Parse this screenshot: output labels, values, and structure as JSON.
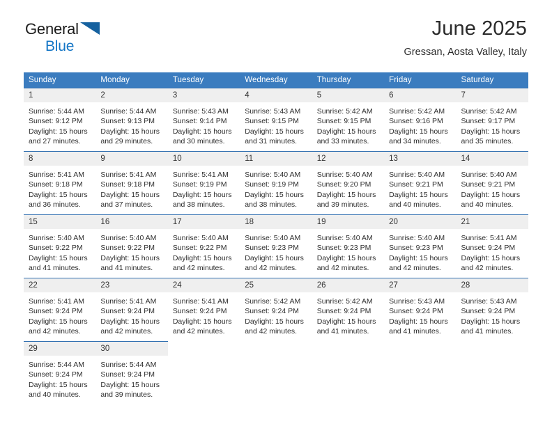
{
  "brand": {
    "line1": "General",
    "line2": "Blue",
    "mark_icon": "blue-triangle-logo-icon",
    "line2_color": "#1476c6",
    "mark_color": "#15619f"
  },
  "header": {
    "title": "June 2025",
    "subtitle": "Gressan, Aosta Valley, Italy"
  },
  "theme": {
    "header_row_bg": "#3b7cbf",
    "header_row_text": "#ffffff",
    "row_border": "#2f6eb0",
    "daynum_bg": "#efefef",
    "body_text": "#2d2d2d"
  },
  "weekday_headers": [
    "Sunday",
    "Monday",
    "Tuesday",
    "Wednesday",
    "Thursday",
    "Friday",
    "Saturday"
  ],
  "labels": {
    "sunrise_prefix": "Sunrise:",
    "sunset_prefix": "Sunset:",
    "daylight_prefix": "Daylight:"
  },
  "weeks": [
    [
      {
        "day": "1",
        "sunrise": "Sunrise: 5:44 AM",
        "sunset": "Sunset: 9:12 PM",
        "daylight_line1": "Daylight: 15 hours",
        "daylight_line2": "and 27 minutes."
      },
      {
        "day": "2",
        "sunrise": "Sunrise: 5:44 AM",
        "sunset": "Sunset: 9:13 PM",
        "daylight_line1": "Daylight: 15 hours",
        "daylight_line2": "and 29 minutes."
      },
      {
        "day": "3",
        "sunrise": "Sunrise: 5:43 AM",
        "sunset": "Sunset: 9:14 PM",
        "daylight_line1": "Daylight: 15 hours",
        "daylight_line2": "and 30 minutes."
      },
      {
        "day": "4",
        "sunrise": "Sunrise: 5:43 AM",
        "sunset": "Sunset: 9:15 PM",
        "daylight_line1": "Daylight: 15 hours",
        "daylight_line2": "and 31 minutes."
      },
      {
        "day": "5",
        "sunrise": "Sunrise: 5:42 AM",
        "sunset": "Sunset: 9:15 PM",
        "daylight_line1": "Daylight: 15 hours",
        "daylight_line2": "and 33 minutes."
      },
      {
        "day": "6",
        "sunrise": "Sunrise: 5:42 AM",
        "sunset": "Sunset: 9:16 PM",
        "daylight_line1": "Daylight: 15 hours",
        "daylight_line2": "and 34 minutes."
      },
      {
        "day": "7",
        "sunrise": "Sunrise: 5:42 AM",
        "sunset": "Sunset: 9:17 PM",
        "daylight_line1": "Daylight: 15 hours",
        "daylight_line2": "and 35 minutes."
      }
    ],
    [
      {
        "day": "8",
        "sunrise": "Sunrise: 5:41 AM",
        "sunset": "Sunset: 9:18 PM",
        "daylight_line1": "Daylight: 15 hours",
        "daylight_line2": "and 36 minutes."
      },
      {
        "day": "9",
        "sunrise": "Sunrise: 5:41 AM",
        "sunset": "Sunset: 9:18 PM",
        "daylight_line1": "Daylight: 15 hours",
        "daylight_line2": "and 37 minutes."
      },
      {
        "day": "10",
        "sunrise": "Sunrise: 5:41 AM",
        "sunset": "Sunset: 9:19 PM",
        "daylight_line1": "Daylight: 15 hours",
        "daylight_line2": "and 38 minutes."
      },
      {
        "day": "11",
        "sunrise": "Sunrise: 5:40 AM",
        "sunset": "Sunset: 9:19 PM",
        "daylight_line1": "Daylight: 15 hours",
        "daylight_line2": "and 38 minutes."
      },
      {
        "day": "12",
        "sunrise": "Sunrise: 5:40 AM",
        "sunset": "Sunset: 9:20 PM",
        "daylight_line1": "Daylight: 15 hours",
        "daylight_line2": "and 39 minutes."
      },
      {
        "day": "13",
        "sunrise": "Sunrise: 5:40 AM",
        "sunset": "Sunset: 9:21 PM",
        "daylight_line1": "Daylight: 15 hours",
        "daylight_line2": "and 40 minutes."
      },
      {
        "day": "14",
        "sunrise": "Sunrise: 5:40 AM",
        "sunset": "Sunset: 9:21 PM",
        "daylight_line1": "Daylight: 15 hours",
        "daylight_line2": "and 40 minutes."
      }
    ],
    [
      {
        "day": "15",
        "sunrise": "Sunrise: 5:40 AM",
        "sunset": "Sunset: 9:22 PM",
        "daylight_line1": "Daylight: 15 hours",
        "daylight_line2": "and 41 minutes."
      },
      {
        "day": "16",
        "sunrise": "Sunrise: 5:40 AM",
        "sunset": "Sunset: 9:22 PM",
        "daylight_line1": "Daylight: 15 hours",
        "daylight_line2": "and 41 minutes."
      },
      {
        "day": "17",
        "sunrise": "Sunrise: 5:40 AM",
        "sunset": "Sunset: 9:22 PM",
        "daylight_line1": "Daylight: 15 hours",
        "daylight_line2": "and 42 minutes."
      },
      {
        "day": "18",
        "sunrise": "Sunrise: 5:40 AM",
        "sunset": "Sunset: 9:23 PM",
        "daylight_line1": "Daylight: 15 hours",
        "daylight_line2": "and 42 minutes."
      },
      {
        "day": "19",
        "sunrise": "Sunrise: 5:40 AM",
        "sunset": "Sunset: 9:23 PM",
        "daylight_line1": "Daylight: 15 hours",
        "daylight_line2": "and 42 minutes."
      },
      {
        "day": "20",
        "sunrise": "Sunrise: 5:40 AM",
        "sunset": "Sunset: 9:23 PM",
        "daylight_line1": "Daylight: 15 hours",
        "daylight_line2": "and 42 minutes."
      },
      {
        "day": "21",
        "sunrise": "Sunrise: 5:41 AM",
        "sunset": "Sunset: 9:24 PM",
        "daylight_line1": "Daylight: 15 hours",
        "daylight_line2": "and 42 minutes."
      }
    ],
    [
      {
        "day": "22",
        "sunrise": "Sunrise: 5:41 AM",
        "sunset": "Sunset: 9:24 PM",
        "daylight_line1": "Daylight: 15 hours",
        "daylight_line2": "and 42 minutes."
      },
      {
        "day": "23",
        "sunrise": "Sunrise: 5:41 AM",
        "sunset": "Sunset: 9:24 PM",
        "daylight_line1": "Daylight: 15 hours",
        "daylight_line2": "and 42 minutes."
      },
      {
        "day": "24",
        "sunrise": "Sunrise: 5:41 AM",
        "sunset": "Sunset: 9:24 PM",
        "daylight_line1": "Daylight: 15 hours",
        "daylight_line2": "and 42 minutes."
      },
      {
        "day": "25",
        "sunrise": "Sunrise: 5:42 AM",
        "sunset": "Sunset: 9:24 PM",
        "daylight_line1": "Daylight: 15 hours",
        "daylight_line2": "and 42 minutes."
      },
      {
        "day": "26",
        "sunrise": "Sunrise: 5:42 AM",
        "sunset": "Sunset: 9:24 PM",
        "daylight_line1": "Daylight: 15 hours",
        "daylight_line2": "and 41 minutes."
      },
      {
        "day": "27",
        "sunrise": "Sunrise: 5:43 AM",
        "sunset": "Sunset: 9:24 PM",
        "daylight_line1": "Daylight: 15 hours",
        "daylight_line2": "and 41 minutes."
      },
      {
        "day": "28",
        "sunrise": "Sunrise: 5:43 AM",
        "sunset": "Sunset: 9:24 PM",
        "daylight_line1": "Daylight: 15 hours",
        "daylight_line2": "and 41 minutes."
      }
    ],
    [
      {
        "day": "29",
        "sunrise": "Sunrise: 5:44 AM",
        "sunset": "Sunset: 9:24 PM",
        "daylight_line1": "Daylight: 15 hours",
        "daylight_line2": "and 40 minutes."
      },
      {
        "day": "30",
        "sunrise": "Sunrise: 5:44 AM",
        "sunset": "Sunset: 9:24 PM",
        "daylight_line1": "Daylight: 15 hours",
        "daylight_line2": "and 39 minutes."
      },
      {
        "day": "",
        "sunrise": "",
        "sunset": "",
        "daylight_line1": "",
        "daylight_line2": ""
      },
      {
        "day": "",
        "sunrise": "",
        "sunset": "",
        "daylight_line1": "",
        "daylight_line2": ""
      },
      {
        "day": "",
        "sunrise": "",
        "sunset": "",
        "daylight_line1": "",
        "daylight_line2": ""
      },
      {
        "day": "",
        "sunrise": "",
        "sunset": "",
        "daylight_line1": "",
        "daylight_line2": ""
      },
      {
        "day": "",
        "sunrise": "",
        "sunset": "",
        "daylight_line1": "",
        "daylight_line2": ""
      }
    ]
  ]
}
